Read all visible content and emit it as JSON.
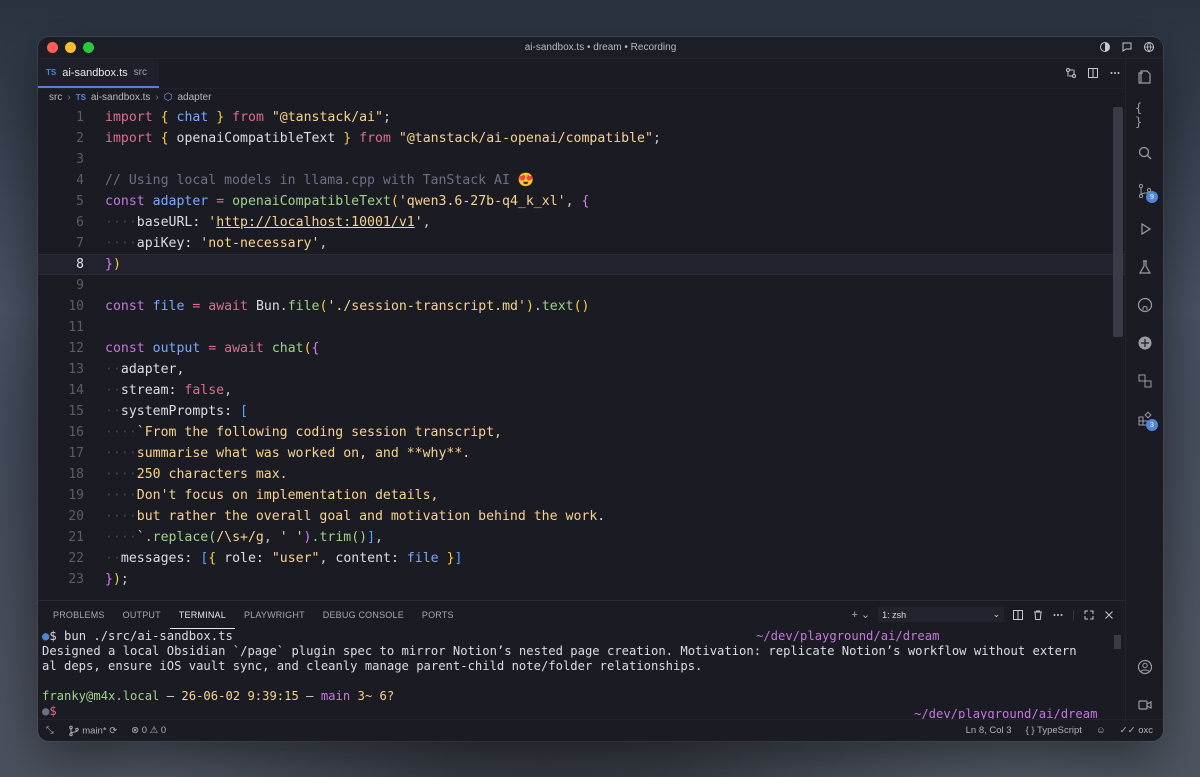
{
  "window": {
    "title": "ai-sandbox.ts • dream • Recording"
  },
  "tab": {
    "badge": "TS",
    "filename": "ai-sandbox.ts",
    "folder": "src"
  },
  "breadcrumb": {
    "folder": "src",
    "badge": "TS",
    "file": "ai-sandbox.ts",
    "symbol": "adapter"
  },
  "editor": {
    "line_numbers": [
      "1",
      "2",
      "3",
      "4",
      "5",
      "6",
      "7",
      "8",
      "9",
      "10",
      "11",
      "12",
      "13",
      "14",
      "15",
      "16",
      "17",
      "18",
      "19",
      "20",
      "21",
      "22",
      "23"
    ],
    "current_line": "8",
    "lines": {
      "l1": [
        "import",
        "{",
        "chat",
        "}",
        "from",
        "\"@tanstack/ai\"",
        ";"
      ],
      "l2": [
        "import",
        "{",
        "openaiCompatibleText",
        "}",
        "from",
        "\"@tanstack/ai-openai/compatible\"",
        ";"
      ],
      "l4": [
        "// Using local models in llama.cpp with TanStack AI 😍"
      ],
      "l5": [
        "const",
        "adapter",
        "=",
        "openaiCompatibleText",
        "(",
        "'qwen3.6-27b-q4_k_xl'",
        ",",
        "{"
      ],
      "l6": [
        "baseURL:",
        "'",
        "http://localhost:10001/v1",
        "'",
        ","
      ],
      "l7": [
        "apiKey:",
        "'not-necessary'",
        ","
      ],
      "l8": [
        "}",
        ")"
      ],
      "l10": [
        "const",
        "file",
        "=",
        "await",
        "Bun",
        ".",
        "file",
        "(",
        "'./session-transcript.md'",
        ")",
        ".",
        "text",
        "()"
      ],
      "l12": [
        "const",
        "output",
        "=",
        "await",
        "chat",
        "(",
        "{"
      ],
      "l13": [
        "adapter,"
      ],
      "l14": [
        "stream:",
        "false",
        ","
      ],
      "l15": [
        "systemPrompts:",
        "["
      ],
      "l16": [
        "`From the following coding session transcript,"
      ],
      "l17": [
        "summarise what was worked on, and **why**."
      ],
      "l18": [
        "250 characters max."
      ],
      "l19": [
        "Don't focus on implementation details,"
      ],
      "l20": [
        "but rather the overall goal and motivation behind the work."
      ],
      "l21": [
        "`",
        ".replace(",
        "/\\s+/g",
        ",",
        " ' '",
        ")",
        ".trim()",
        "]",
        ","
      ],
      "l22": [
        "messages:",
        "[",
        "{",
        "role:",
        "\"user\"",
        ",",
        "content:",
        "file",
        "}",
        "]"
      ],
      "l23": [
        "}",
        ")",
        ";"
      ]
    }
  },
  "panel": {
    "tabs": [
      "PROBLEMS",
      "OUTPUT",
      "TERMINAL",
      "PLAYWRIGHT",
      "DEBUG CONSOLE",
      "PORTS"
    ],
    "active_tab": "TERMINAL",
    "terminal_select": "1: zsh",
    "terminal": {
      "cmd": "$ bun ./src/ai-sandbox.ts",
      "cwd": "~/dev/playground/ai/dream",
      "out1": "Designed a local Obsidian `/page` plugin spec to mirror Notion’s nested page creation. Motivation: replicate Notion’s workflow without extern",
      "out2": "al deps, ensure iOS vault sync, and cleanly manage parent-child note/folder relationships.",
      "user": "franky@m4x.local",
      "dash": " – ",
      "datetime": "26-06-02 9:39:15",
      "branch": "main",
      "status": "3~ 6?",
      "prompt": "$",
      "cwd2": "~/dev/playground/ai/dream"
    }
  },
  "status": {
    "branch": "main*",
    "errors": "0",
    "warnings": "0",
    "position": "Ln 8, Col 3",
    "braces": "{ }",
    "language": "TypeScript",
    "extension": "oxc"
  },
  "activity": {
    "scm_badge": "9",
    "ext_badge": "3"
  },
  "colors": {
    "accent": "#4f86d6",
    "background": "#1b1b24",
    "keyword": "#e06c8a",
    "string": "#f6d38f",
    "variable": "#7aa9ff",
    "function": "#9fd28c"
  }
}
